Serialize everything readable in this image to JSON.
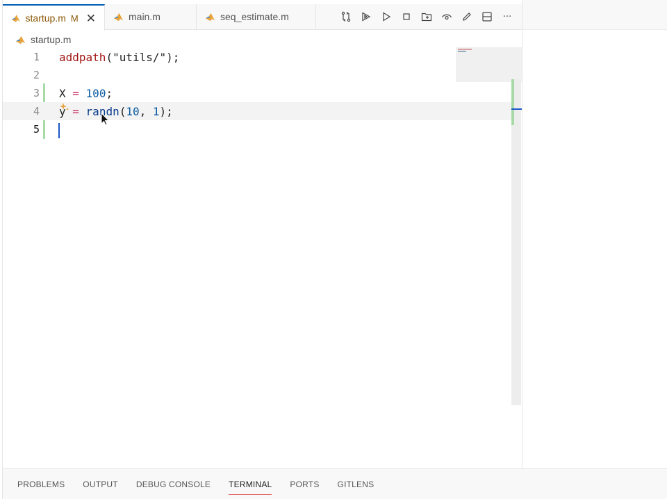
{
  "tabs": [
    {
      "name": "startup.m",
      "badge": "M",
      "close": "✕",
      "active": true
    },
    {
      "name": "main.m",
      "active": false
    },
    {
      "name": "seq_estimate.m",
      "active": false
    }
  ],
  "toolbar_icons": [
    "compare-changes-icon",
    "run-section-icon",
    "run-icon",
    "stop-icon",
    "open-folder-icon",
    "preview-icon",
    "edit-icon",
    "split-editor-icon",
    "more-actions-icon"
  ],
  "more_label": "···",
  "breadcrumb": {
    "file": "startup.m"
  },
  "editor": {
    "line_numbers": [
      "1",
      "2",
      "3",
      "4",
      "5"
    ],
    "lines": [
      {
        "fn": "addpath",
        "rest": "(\"utils/\");"
      },
      {},
      {
        "var": "X",
        "op": " = ",
        "num": "100",
        "end": ";"
      },
      {
        "var": "y",
        "op": "= ",
        "call": "randn",
        "args_open": "(",
        "a1": "10",
        "sep": ", ",
        "a2": "1",
        "args_close": ");"
      },
      {}
    ],
    "active_line": 5
  },
  "panel": {
    "tabs": [
      "PROBLEMS",
      "OUTPUT",
      "DEBUG CONSOLE",
      "TERMINAL",
      "PORTS",
      "GITLENS"
    ],
    "active": "TERMINAL"
  },
  "colors": {
    "accent": "#005fb8",
    "modified": "#895503",
    "gutter_added": "#a6dba8",
    "active_panel_underline": "#e26a6a"
  }
}
